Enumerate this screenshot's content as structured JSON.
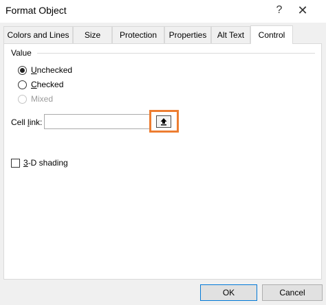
{
  "window": {
    "title": "Format Object",
    "help_glyph": "?",
    "close_glyph": "✕"
  },
  "tabs": [
    {
      "label": "Colors and Lines",
      "active": false
    },
    {
      "label": "Size",
      "active": false
    },
    {
      "label": "Protection",
      "active": false
    },
    {
      "label": "Properties",
      "active": false
    },
    {
      "label": "Alt Text",
      "active": false
    },
    {
      "label": "Control",
      "active": true
    }
  ],
  "value_group": {
    "label": "Value",
    "options": [
      {
        "label": "Unchecked",
        "mnemonic": "U",
        "rest": "nchecked",
        "selected": true,
        "disabled": false
      },
      {
        "label": "Checked",
        "mnemonic": "C",
        "rest": "hecked",
        "selected": false,
        "disabled": false
      },
      {
        "label": "Mixed",
        "mnemonic": "",
        "rest": "Mixed",
        "selected": false,
        "disabled": true
      }
    ]
  },
  "cell_link": {
    "label_pre": "Cell ",
    "label_mnemonic": "l",
    "label_post": "ink:",
    "value": "",
    "highlight_color": "#ed7d31"
  },
  "shading": {
    "mnemonic": "3",
    "rest": "-D shading",
    "checked": false
  },
  "footer": {
    "ok_label": "OK",
    "cancel_label": "Cancel"
  }
}
